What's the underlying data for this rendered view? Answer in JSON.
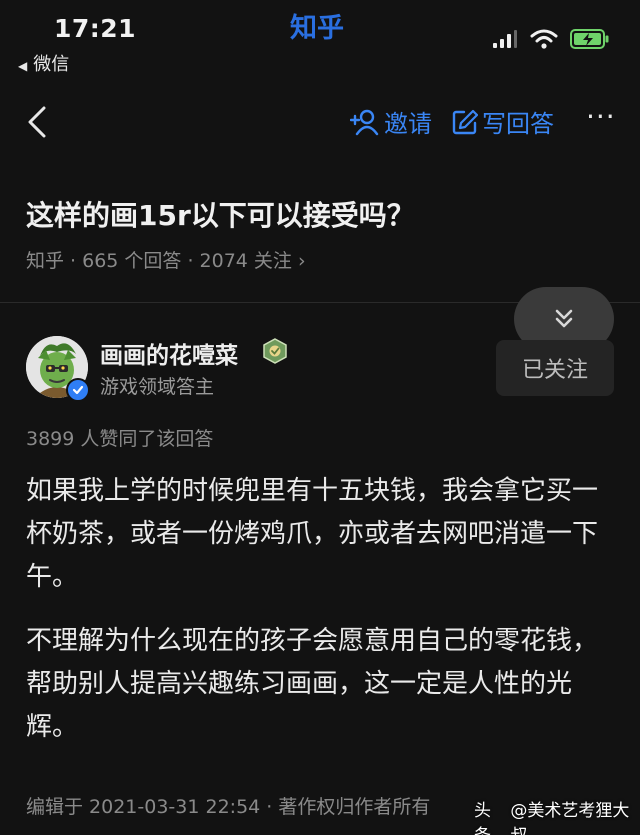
{
  "status_bar": {
    "time": "17:21",
    "back_app": "微信",
    "app_name": "知乎",
    "icons": [
      "signal-icon",
      "wifi-icon",
      "battery-charging-icon"
    ]
  },
  "nav": {
    "back_icon": "chevron-left-icon",
    "invite_label": "邀请",
    "write_label": "写回答",
    "more_label": "···"
  },
  "question": {
    "title": "这样的画15r以下可以接受吗？",
    "meta": "知乎 · 665 个回答 · 2074 关注 ›"
  },
  "author": {
    "name": "画画的花噎菜",
    "bio": "游戏领域答主",
    "follow_label": "已关注",
    "verified": true
  },
  "answer": {
    "votes": "3899 人赞同了该回答",
    "paragraphs": [
      "如果我上学的时候兜里有十五块钱，我会拿它买一杯奶茶，或者一份烤鸡爪，亦或者去网吧消遣一下午。",
      "不理解为什么现在的孩子会愿意用自己的零花钱，帮助别人提高兴趣练习画画，这一定是人性的光辉。"
    ],
    "edit_info": "编辑于 2021-03-31 22:54 · 著作权归作者所有"
  },
  "watermark": {
    "prefix": "头条",
    "text": "@美术艺考狸大叔"
  },
  "colors": {
    "background": "#121212",
    "accent": "#3a86f5",
    "brand": "#2a6fe0",
    "muted_text": "#8a8a8a"
  }
}
